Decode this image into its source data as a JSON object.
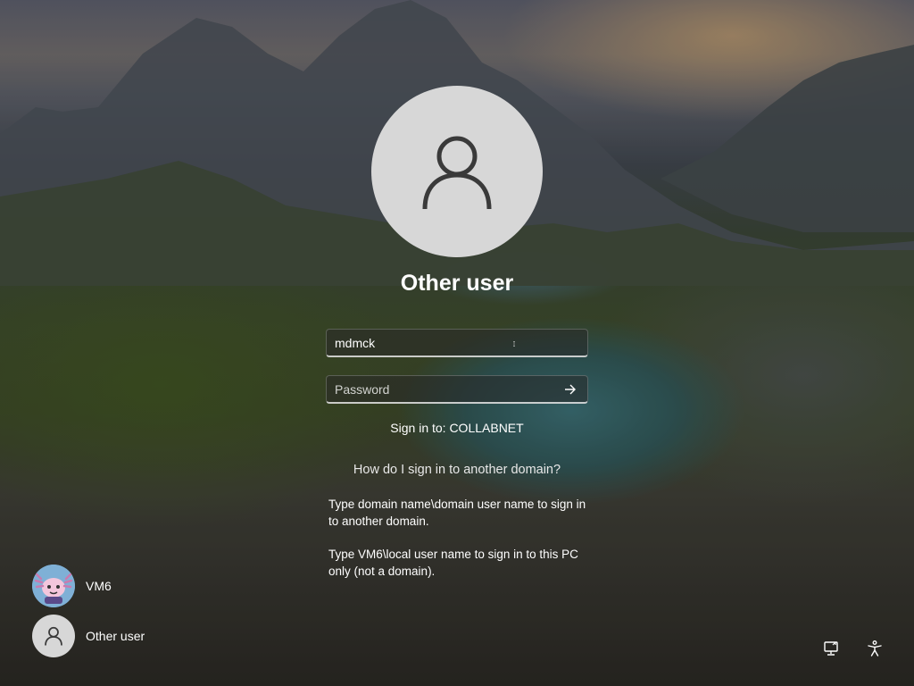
{
  "login": {
    "display_name": "Other user",
    "username_value": "mdmck",
    "password_placeholder": "Password",
    "sign_in_to": "Sign in to: COLLABNET",
    "help_link": "How do I sign in to another domain?",
    "help_text_1": "Type domain name\\domain user name to sign in to another domain.",
    "help_text_2": "Type VM6\\local user name to sign in to this PC only (not a domain)."
  },
  "users": [
    {
      "label": "VM6",
      "avatar": "axolotl-avatar"
    },
    {
      "label": "Other user",
      "avatar": "person-icon"
    }
  ],
  "icons": {
    "large_avatar": "person-icon",
    "submit": "arrow-right-icon",
    "network": "network-icon",
    "accessibility": "accessibility-icon"
  },
  "colors": {
    "avatar_bg": "#d7d7d7",
    "avatar_glyph": "#3a3a3a"
  }
}
